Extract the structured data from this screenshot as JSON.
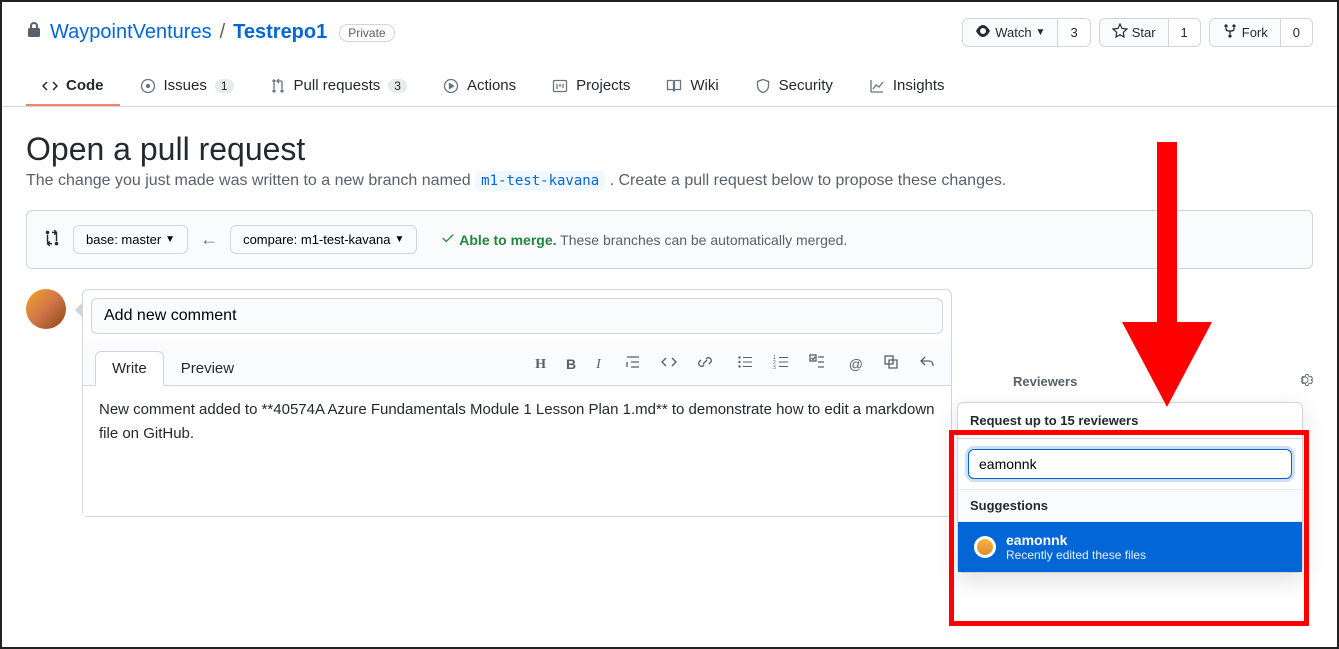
{
  "repo": {
    "owner": "WaypointVentures",
    "name": "Testrepo1",
    "visibility": "Private"
  },
  "actions": {
    "watch": {
      "label": "Watch",
      "count": "3"
    },
    "star": {
      "label": "Star",
      "count": "1"
    },
    "fork": {
      "label": "Fork",
      "count": "0"
    }
  },
  "tabs": {
    "code": "Code",
    "issues": {
      "label": "Issues",
      "count": "1"
    },
    "pulls": {
      "label": "Pull requests",
      "count": "3"
    },
    "actions": "Actions",
    "projects": "Projects",
    "wiki": "Wiki",
    "security": "Security",
    "insights": "Insights"
  },
  "page": {
    "title": "Open a pull request",
    "subtitle_pre": "The change you just made was written to a new branch named ",
    "branch": "m1-test-kavana",
    "subtitle_post": " . Create a pull request below to propose these changes."
  },
  "compare": {
    "base": "base: master",
    "compare": "compare: m1-test-kavana",
    "merge_status": "Able to merge.",
    "merge_detail": "These branches can be automatically merged."
  },
  "editor": {
    "title_value": "Add new comment",
    "write_tab": "Write",
    "preview_tab": "Preview",
    "body": "New comment added to **40574A Azure Fundamentals Module 1 Lesson Plan 1.md** to demonstrate how to edit a markdown file on GitHub."
  },
  "sidebar": {
    "reviewers_label": "Reviewers"
  },
  "popup": {
    "header": "Request up to 15 reviewers",
    "search_value": "eamonnk",
    "suggestions_label": "Suggestions",
    "suggestion": {
      "name": "eamonnk",
      "sub": "Recently edited these files"
    }
  }
}
